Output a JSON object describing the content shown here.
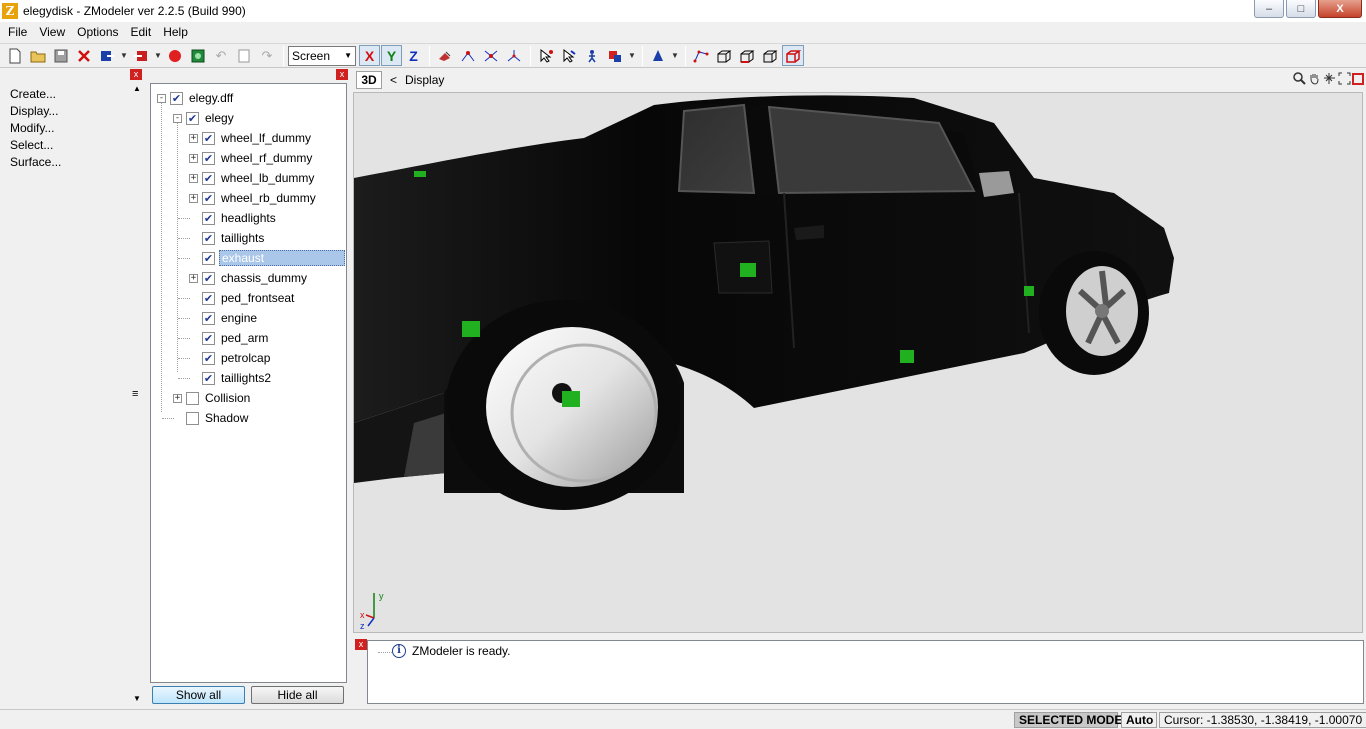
{
  "window": {
    "title": "elegydisk - ZModeler ver 2.2.5 (Build 990)",
    "icon_letter": "Z",
    "minimize_glyph": "–",
    "maximize_glyph": "□",
    "close_glyph": "X"
  },
  "menu": [
    {
      "label": "File",
      "accel": "F"
    },
    {
      "label": "View",
      "accel": "V"
    },
    {
      "label": "Options",
      "accel": "O"
    },
    {
      "label": "Edit",
      "accel": "E"
    },
    {
      "label": "Help",
      "accel": "H"
    }
  ],
  "toolbar": {
    "coord_space": "Screen",
    "axes": [
      "X",
      "Y",
      "Z"
    ],
    "axis_colors": {
      "X": "#d01010",
      "Y": "#108010",
      "Z": "#1030c0"
    },
    "icons": [
      "new-file-icon",
      "open-folder-icon",
      "save-icon",
      "delete-icon",
      "import-icon",
      "export-icon",
      "record-icon",
      "snapshot-icon",
      "undo-icon",
      "copy-icon",
      "redo-icon"
    ]
  },
  "command_panel": {
    "items": [
      "Create...",
      "Display...",
      "Modify...",
      "Select...",
      "Surface..."
    ],
    "close_glyph": "x",
    "grip_glyph": "≡"
  },
  "tree": {
    "items": [
      {
        "label": "elegy.dff",
        "level": 0,
        "expander": "-",
        "checked": true
      },
      {
        "label": "elegy",
        "level": 1,
        "expander": "-",
        "checked": true
      },
      {
        "label": "wheel_lf_dummy",
        "level": 2,
        "expander": "+",
        "checked": true
      },
      {
        "label": "wheel_rf_dummy",
        "level": 2,
        "expander": "+",
        "checked": true
      },
      {
        "label": "wheel_lb_dummy",
        "level": 2,
        "expander": "+",
        "checked": true
      },
      {
        "label": "wheel_rb_dummy",
        "level": 2,
        "expander": "+",
        "checked": true
      },
      {
        "label": "headlights",
        "level": 2,
        "expander": "",
        "checked": true
      },
      {
        "label": "taillights",
        "level": 2,
        "expander": "",
        "checked": true
      },
      {
        "label": "exhaust",
        "level": 2,
        "expander": "",
        "checked": true,
        "selected": true
      },
      {
        "label": "chassis_dummy",
        "level": 2,
        "expander": "+",
        "checked": true
      },
      {
        "label": "ped_frontseat",
        "level": 2,
        "expander": "",
        "checked": true
      },
      {
        "label": "engine",
        "level": 2,
        "expander": "",
        "checked": true
      },
      {
        "label": "ped_arm",
        "level": 2,
        "expander": "",
        "checked": true
      },
      {
        "label": "petrolcap",
        "level": 2,
        "expander": "",
        "checked": true
      },
      {
        "label": "taillights2",
        "level": 2,
        "expander": "",
        "checked": true
      },
      {
        "label": "Collision",
        "level": 1,
        "expander": "+",
        "checked": false
      },
      {
        "label": "Shadow",
        "level": 1,
        "expander": "",
        "checked": false
      }
    ],
    "show_all_label": "Show all",
    "hide_all_label": "Hide all",
    "check_glyph": "✔"
  },
  "viewport": {
    "mode_label": "3D",
    "back_glyph": "<",
    "title": "Display",
    "axis_labels": {
      "x": "x",
      "y": "y",
      "z": "z"
    },
    "colors": {
      "background": "#e3e3e3",
      "body": "#0d0d0d",
      "marker": "#20b020"
    }
  },
  "log": {
    "message": "ZModeler is ready.",
    "info_glyph": "i"
  },
  "status": {
    "mode": "SELECTED MODE",
    "snap": "Auto",
    "cursor": "Cursor: -1.38530, -1.38419, -1.00070"
  }
}
